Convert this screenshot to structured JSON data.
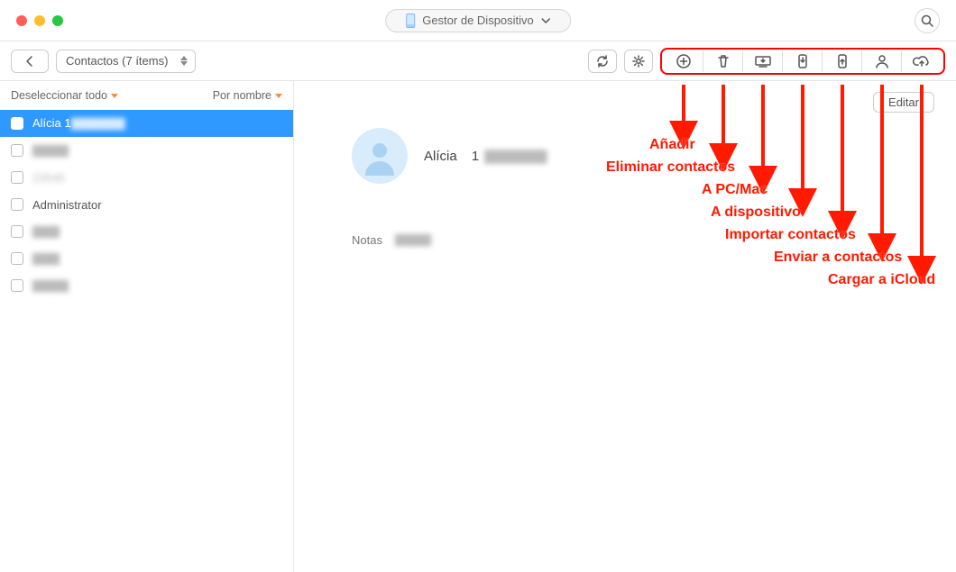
{
  "titlebar": {
    "mode_label": "Gestor de Dispositivo"
  },
  "toolbar": {
    "breadcrumb_label": "Contactos (7 ítems)",
    "icon_strip": {
      "add": "add-icon",
      "delete": "trash-icon",
      "to_pc": "to-pc-icon",
      "to_dev": "to-device-icon",
      "import": "import-icon",
      "send": "send-contact-icon",
      "icloud": "icloud-upload-icon"
    }
  },
  "sidebar": {
    "deselect_label": "Deseleccionar todo",
    "sort_label": "Por nombre",
    "items": [
      {
        "label": "Alícia 1",
        "selected": true,
        "redacted_suffix": true
      },
      {
        "label": "—",
        "selected": false,
        "redacted_suffix": false,
        "blur": true
      },
      {
        "label": "23545",
        "selected": false,
        "redacted_suffix": false,
        "blur": true
      },
      {
        "label": "Administrator",
        "selected": false,
        "redacted_suffix": false
      },
      {
        "label": "—",
        "selected": false,
        "blur": true
      },
      {
        "label": "—",
        "selected": false,
        "blur": true
      },
      {
        "label": "—",
        "selected": false,
        "blur": true
      }
    ]
  },
  "detail": {
    "edit_label": "Editar",
    "contact_name_prefix": "Alícia",
    "contact_name_rest": "1",
    "notes_label": "Notas"
  },
  "annotations": {
    "add": "Añadir",
    "delete": "Eliminar contactos",
    "to_pc": "A PC/Mac",
    "to_dev": "A dispositivo",
    "import": "Importar contactos",
    "send": "Enviar a contactos",
    "icloud": "Cargar a iCloud"
  }
}
